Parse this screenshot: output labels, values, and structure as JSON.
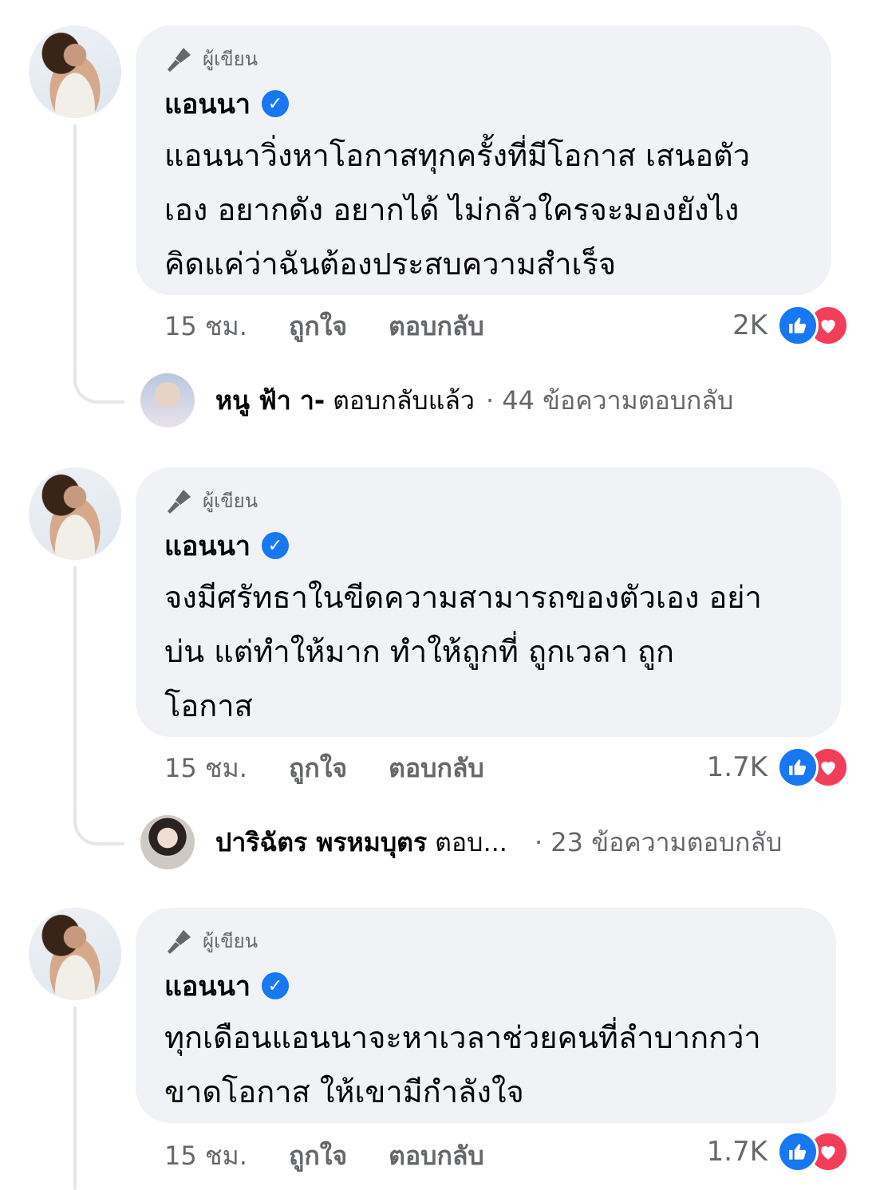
{
  "comments": [
    {
      "badge": "ผู้เขียน",
      "name": "แอนนา",
      "lines": [
        "แอนนาวิ่งหาโอกาสทุกครั้งที่มีโอกาส เสนอตัว",
        "เอง อยากดัง อยากได้ ไม่กลัวใครจะมองยังไง",
        "คิดแค่ว่าฉันต้องประสบความสำเร็จ"
      ],
      "time": "15 ชม.",
      "like_label": "ถูกใจ",
      "reply_label": "ตอบกลับ",
      "reaction_count": "2K",
      "reply": {
        "name": "หนู ฟ้า า-",
        "status": "ตอบกลับแล้ว",
        "count": "· 44 ข้อความตอบกลับ"
      }
    },
    {
      "badge": "ผู้เขียน",
      "name": "แอนนา",
      "lines": [
        "จงมีศรัทธาในขีดความสามารถของตัวเอง อย่า",
        "บ่น แต่ทำให้มาก ทำให้ถูกที่ ถูกเวลา ถูก",
        "โอกาส"
      ],
      "time": "15 ชม.",
      "like_label": "ถูกใจ",
      "reply_label": "ตอบกลับ",
      "reaction_count": "1.7K",
      "reply": {
        "name": "ปาริฉัตร พรหมบุตร",
        "status": "ตอบ...",
        "count": "· 23 ข้อความตอบกลับ"
      }
    },
    {
      "badge": "ผู้เขียน",
      "name": "แอนนา",
      "lines": [
        "ทุกเดือนแอนนาจะหาเวลาช่วยคนที่ลำบากกว่า",
        "ขาดโอกาส ให้เขามีกำลังใจ"
      ],
      "time": "15 ชม.",
      "like_label": "ถูกใจ",
      "reply_label": "ตอบกลับ",
      "reaction_count": "1.7K"
    }
  ],
  "icons": {
    "author": "microphone-icon",
    "verified": "verified-check-icon",
    "like": "thumbs-up-icon",
    "love": "heart-icon"
  },
  "colors": {
    "like": "#1877f2",
    "love": "#f33e58",
    "bubble": "#f0f2f5"
  }
}
